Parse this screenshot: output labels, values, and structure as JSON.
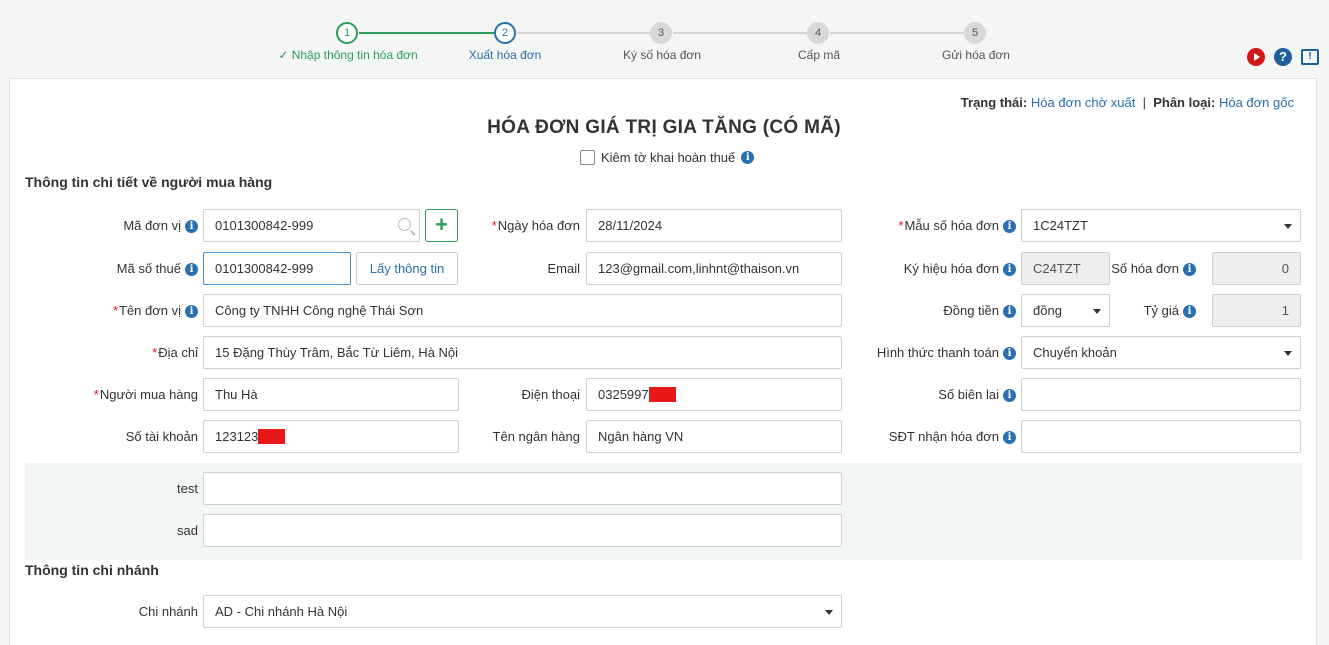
{
  "steps": [
    {
      "num": "1",
      "label": "✓ Nhập thông tin hóa đơn",
      "state": "done"
    },
    {
      "num": "2",
      "label": "Xuất hóa đơn",
      "state": "active"
    },
    {
      "num": "3",
      "label": "Ký số hóa đơn",
      "state": "todo"
    },
    {
      "num": "4",
      "label": "Cấp mã",
      "state": "todo"
    },
    {
      "num": "5",
      "label": "Gửi hóa đơn",
      "state": "todo"
    }
  ],
  "top_icons": {
    "help": "?",
    "chat": "!"
  },
  "status": {
    "state_label": "Trạng thái:",
    "state_value": "Hóa đơn chờ xuất",
    "separator": "|",
    "type_label": "Phân loại:",
    "type_value": "Hóa đơn gốc"
  },
  "title": "HÓA ĐƠN GIÁ TRỊ GIA TĂNG (CÓ MÃ)",
  "refund_checkbox": {
    "label": "Kiêm tờ khai hoàn thuế",
    "checked": false
  },
  "info_glyph": "i",
  "sections": {
    "buyer": "Thông tin chi tiết về người mua hàng",
    "branch": "Thông tin chi nhánh"
  },
  "buyer": {
    "unit_code": {
      "label": "Mã đơn vị",
      "value": "0101300842-999",
      "add_button": "+"
    },
    "tax_code": {
      "label": "Mã số thuế",
      "value": "0101300842-999",
      "lookup_button": "Lấy thông tin"
    },
    "unit_name": {
      "label": "Tên đơn vị",
      "value": "Công ty TNHH Công nghệ Thái Sơn"
    },
    "address": {
      "label": "Địa chỉ",
      "value": "15 Đặng Thùy Trâm, Bắc Từ Liêm, Hà Nội"
    },
    "buyer_name": {
      "label": "Người mua hàng",
      "value": "Thu Hà"
    },
    "account_no": {
      "label": "Số tài khoản",
      "value": "123123"
    },
    "invoice_date": {
      "label": "Ngày hóa đơn",
      "value": "28/11/2024"
    },
    "email": {
      "label": "Email",
      "value": "123@gmail.com,linhnt@thaison.vn"
    },
    "phone": {
      "label": "Điện thoại",
      "value": "0325997"
    },
    "bank_name": {
      "label": "Tên ngân hàng",
      "value": "Ngân hàng VN"
    }
  },
  "invoice": {
    "template": {
      "label": "Mẫu số hóa đơn",
      "value": "1C24TZT"
    },
    "symbol": {
      "label": "Ký hiệu hóa đơn",
      "value": "C24TZT"
    },
    "number": {
      "label": "Số hóa đơn",
      "value": "0"
    },
    "currency": {
      "label": "Đồng tiền",
      "value": "đồng"
    },
    "rate": {
      "label": "Tỷ giá",
      "value": "1"
    },
    "payment": {
      "label": "Hình thức thanh toán",
      "value": "Chuyển khoản"
    },
    "receipt": {
      "label": "Số biên lai",
      "value": ""
    },
    "receiver_phone": {
      "label": "SĐT nhận hóa đơn",
      "value": ""
    }
  },
  "extra": {
    "test": {
      "label": "test",
      "value": ""
    },
    "sad": {
      "label": "sad",
      "value": ""
    }
  },
  "branch": {
    "label": "Chi nhánh",
    "value": "AD - Chi nhánh Hà Nội"
  },
  "colors": {
    "green": "#2e9e55",
    "blue": "#2a6fae",
    "required": "#dd1122",
    "redact": "#e81818"
  }
}
